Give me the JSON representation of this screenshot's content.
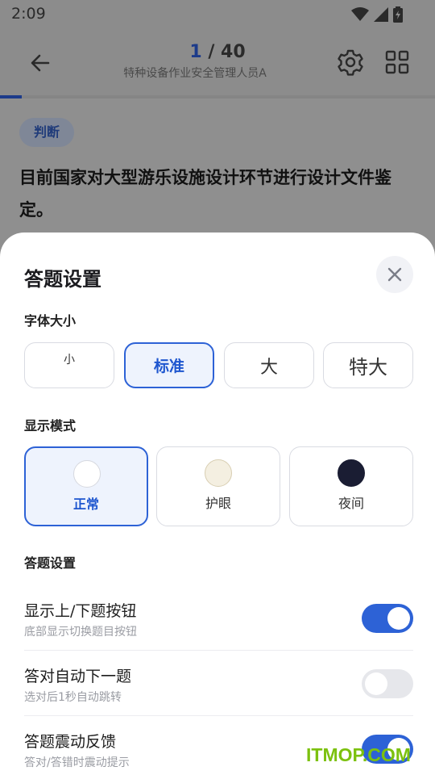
{
  "status": {
    "time": "2:09"
  },
  "header": {
    "current": "1",
    "separator": " / ",
    "total": "40",
    "subject": "特种设备作业安全管理人员A",
    "progress": 0.025
  },
  "question": {
    "type_badge": "判断",
    "text": "目前国家对大型游乐设施设计环节进行设计文件鉴定。"
  },
  "sheet": {
    "title": "答题设置",
    "font_section": "字体大小",
    "font_options": [
      "小",
      "标准",
      "大",
      "特大"
    ],
    "font_selected": "标准",
    "mode_section": "显示模式",
    "modes": [
      {
        "label": "正常",
        "color": "#ffffff"
      },
      {
        "label": "护眼",
        "color": "#f4efe1"
      },
      {
        "label": "夜间",
        "color": "#1a1d33"
      }
    ],
    "mode_selected": "正常",
    "answer_section": "答题设置",
    "settings": [
      {
        "title": "显示上/下题按钮",
        "desc": "底部显示切换题目按钮",
        "on": true
      },
      {
        "title": "答对自动下一题",
        "desc": "选对后1秒自动跳转",
        "on": false
      },
      {
        "title": "答题震动反馈",
        "desc": "答对/答错时震动提示",
        "on": true
      }
    ]
  },
  "watermark": "ITMOP.COM",
  "colors": {
    "accent": "#2d62d6",
    "watermark": "#7cc10f"
  }
}
